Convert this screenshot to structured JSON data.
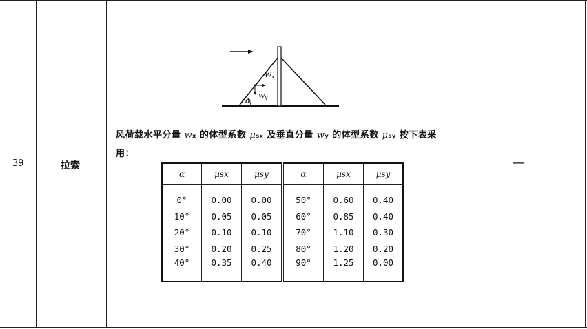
{
  "row": {
    "number": "39",
    "name": "拉索",
    "remark": "—"
  },
  "diagram": {
    "label_wx": "w",
    "label_wx_sub": "x",
    "label_wy": "w",
    "label_wy_sub": "y",
    "label_alpha": "α"
  },
  "description": {
    "text1": "风荷载水平分量 ",
    "wx": "w",
    "wx_sub": "x",
    "text2": " 的体型系数 ",
    "mux": "μ",
    "mux_sub": "sx",
    "text3": " 及垂直分量 ",
    "wy": "w",
    "wy_sub": "y",
    "text4": " 的体型系数 ",
    "muy": "μ",
    "muy_sub": "sy",
    "text5": " 按下表采用："
  },
  "table": {
    "headers": [
      "α",
      "μsx",
      "μsy",
      "α",
      "μsx",
      "μsy"
    ],
    "rows": [
      [
        "0°",
        "0.00",
        "0.00",
        "50°",
        "0.60",
        "0.40"
      ],
      [
        "10°",
        "0.05",
        "0.05",
        "60°",
        "0.85",
        "0.40"
      ],
      [
        "20°",
        "0.10",
        "0.10",
        "70°",
        "1.10",
        "0.30"
      ],
      [
        "30°",
        "0.20",
        "0.25",
        "80°",
        "1.20",
        "0.20"
      ],
      [
        "40°",
        "0.35",
        "0.40",
        "90°",
        "1.25",
        "0.00"
      ]
    ]
  }
}
